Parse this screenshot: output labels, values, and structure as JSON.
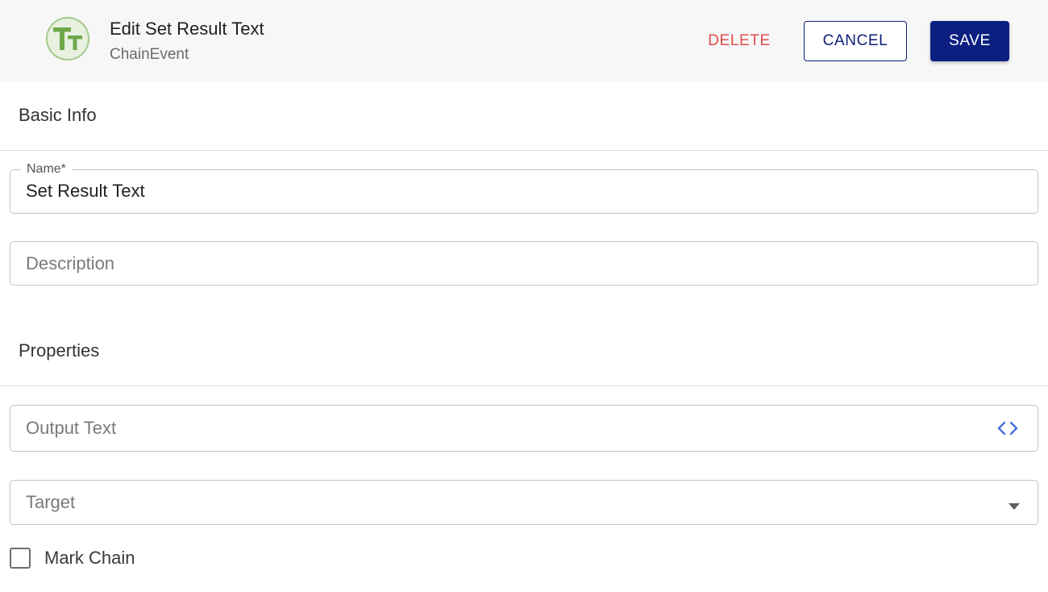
{
  "header": {
    "avatar_icon": "text-type-icon",
    "avatar_color": "#6fa84c",
    "title": "Edit Set Result Text",
    "subtitle": "ChainEvent",
    "delete_label": "DELETE",
    "cancel_label": "CANCEL",
    "save_label": "SAVE"
  },
  "basic_info": {
    "section_title": "Basic Info",
    "name_field": {
      "label": "Name*",
      "value": "Set Result Text"
    },
    "description_field": {
      "placeholder": "Description",
      "value": ""
    }
  },
  "properties": {
    "section_title": "Properties",
    "output_text_field": {
      "placeholder": "Output Text",
      "value": "",
      "trailing_icon": "code-brackets-icon"
    },
    "target_field": {
      "placeholder": "Target",
      "value": "",
      "trailing_icon": "dropdown-arrow-icon"
    },
    "mark_chain": {
      "label": "Mark Chain",
      "checked": false
    }
  },
  "colors": {
    "primary": "#0b1f80",
    "danger": "#e04c4c",
    "icon_blue": "#4a6fd8"
  }
}
